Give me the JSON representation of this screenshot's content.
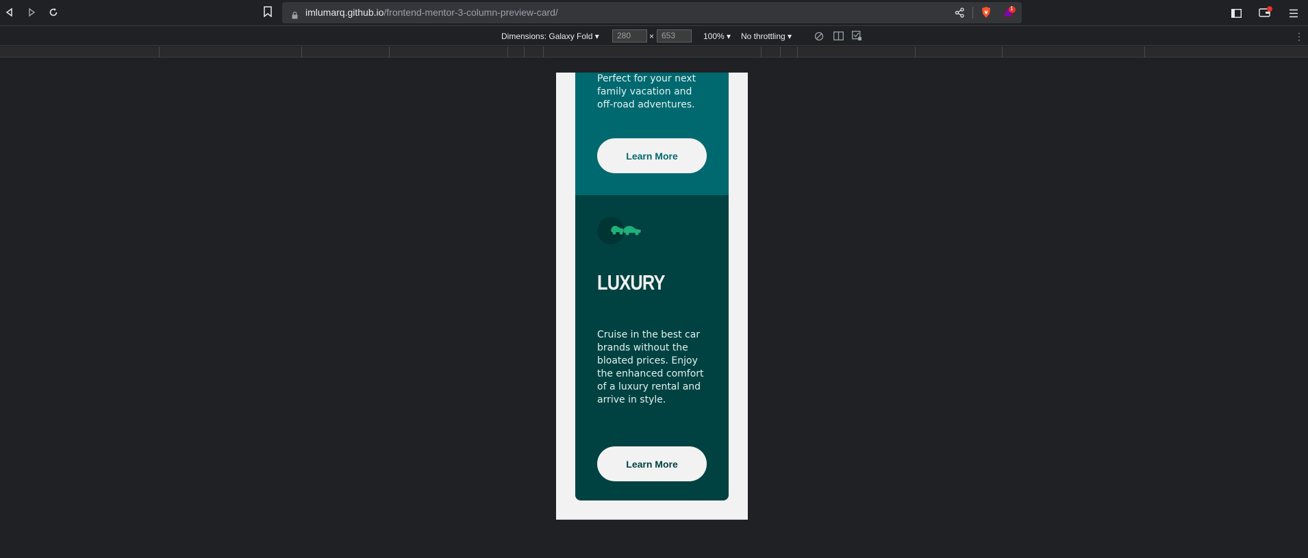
{
  "browser": {
    "url_host": "imlumarq.github.io",
    "url_path": "/frontend-mentor-3-column-preview-card/",
    "notification_count": "1"
  },
  "devtools": {
    "dimensions_label": "Dimensions: Galaxy Fold",
    "width": "280",
    "times": "×",
    "height": "653",
    "zoom": "100%",
    "throttling": "No throttling"
  },
  "page": {
    "top_card": {
      "description": "Perfect for your next family vacation and off-road adventures.",
      "button_label": "Learn More"
    },
    "luxury_card": {
      "title": "LUXURY",
      "description": "Cruise in the best car brands without the bloated prices. Enjoy the enhanced comfort of a luxury rental and arrive in style.",
      "button_label": "Learn More"
    }
  },
  "colors": {
    "dark_cyan": "#006970",
    "very_dark_cyan": "#004241",
    "light_gray": "#f2f2f2",
    "icon_accent": "#1fb07a"
  }
}
